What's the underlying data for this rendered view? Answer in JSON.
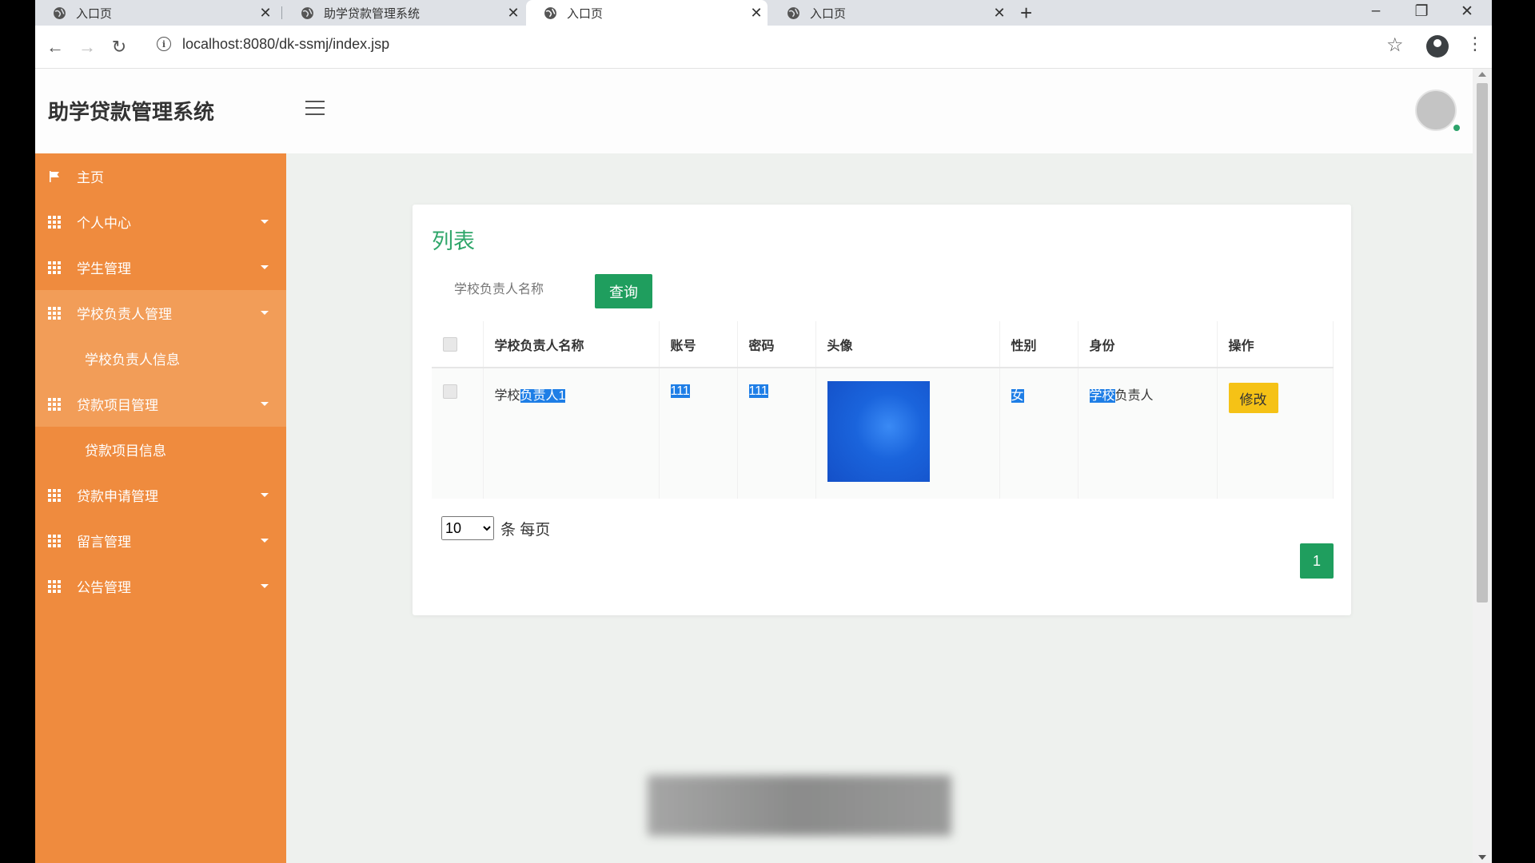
{
  "browser": {
    "tabs": [
      {
        "title": "入口页",
        "active": false
      },
      {
        "title": "助学贷款管理系统",
        "active": false
      },
      {
        "title": "入口页",
        "active": true
      },
      {
        "title": "入口页",
        "active": false
      }
    ],
    "url": "localhost:8080/dk-ssmj/index.jsp"
  },
  "app": {
    "brand": "助学贷款管理系统"
  },
  "sidebar": {
    "items": [
      {
        "label": "主页"
      },
      {
        "label": "个人中心"
      },
      {
        "label": "学生管理"
      },
      {
        "label": "学校负责人管理"
      },
      {
        "label": "学校负责人信息"
      },
      {
        "label": "贷款项目管理"
      },
      {
        "label": "贷款项目信息"
      },
      {
        "label": "贷款申请管理"
      },
      {
        "label": "留言管理"
      },
      {
        "label": "公告管理"
      }
    ]
  },
  "main": {
    "title": "列表",
    "search_placeholder": "学校负责人名称",
    "search_button": "查询",
    "columns": [
      "学校负责人名称",
      "账号",
      "密码",
      "头像",
      "性别",
      "身份",
      "操作"
    ],
    "rows": [
      {
        "name_prefix": "学校",
        "name_sel": "负责人1",
        "account": "111",
        "password": "111",
        "gender": "女",
        "role_sel": "学校",
        "role_rest": "负责人",
        "action": "修改"
      }
    ],
    "page_size": "10",
    "page_size_label": "条 每页",
    "current_page": "1"
  },
  "colors": {
    "sidebar": "#ef8b3e",
    "primary": "#1f9e5e",
    "warning": "#f5c216",
    "title": "#2fa66a"
  }
}
